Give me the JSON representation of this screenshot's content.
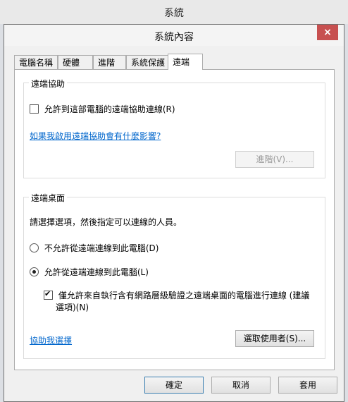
{
  "parent_window": {
    "title": "系統"
  },
  "dialog": {
    "title": "系統內容",
    "close_icon": "×"
  },
  "tabs": [
    {
      "label": "電腦名稱"
    },
    {
      "label": "硬體"
    },
    {
      "label": "進階"
    },
    {
      "label": "系統保護"
    },
    {
      "label": "遠端",
      "active": true
    }
  ],
  "remote_assistance": {
    "group_title": "遠端協助",
    "allow_checkbox": {
      "label": "允許到這部電腦的遠端協助連線(R)",
      "checked": false
    },
    "info_link": "如果我啟用遠端協助會有什麼影響?",
    "advanced_button": "進階(V)..."
  },
  "remote_desktop": {
    "group_title": "遠端桌面",
    "instruction": "請選擇選項，然後指定可以連線的人員。",
    "options": [
      {
        "label": "不允許從遠端連線到此電腦(D)",
        "selected": false
      },
      {
        "label": "允許從遠端連線到此電腦(L)",
        "selected": true
      }
    ],
    "nla_checkbox": {
      "label_line1": "僅允許來自執行含有網路層級驗證之遠端桌面的電腦進行連線 (建議",
      "label_line2": "選項)(N)",
      "checked": true
    },
    "help_link": "協助我選擇",
    "select_users_button": "選取使用者(S)..."
  },
  "footer": {
    "ok_button": "確定",
    "cancel_button": "取消",
    "apply_button": "套用"
  }
}
